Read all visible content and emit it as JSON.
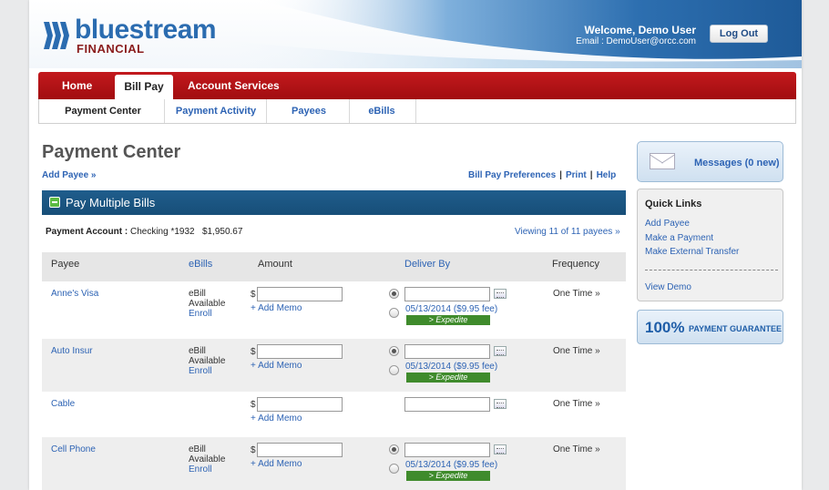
{
  "header": {
    "logo_text": "bluestream",
    "logo_sub": "FINANCIAL",
    "welcome": "Welcome, Demo User",
    "email": "Email : DemoUser@orcc.com",
    "logout_label": "Log Out"
  },
  "main_nav": {
    "tabs": [
      {
        "label": "Home"
      },
      {
        "label": "Bill Pay",
        "active": true
      },
      {
        "label": "Account Services"
      }
    ]
  },
  "sub_nav": {
    "tabs": [
      {
        "label": "Payment Center",
        "active": true
      },
      {
        "label": "Payment Activity"
      },
      {
        "label": "Payees"
      },
      {
        "label": "eBills"
      }
    ]
  },
  "page": {
    "title": "Payment Center",
    "add_payee": "Add Payee »",
    "links": [
      "Bill Pay Preferences",
      "Print",
      "Help"
    ],
    "link_separator": "|"
  },
  "panel": {
    "title": "Pay Multiple Bills",
    "account_label": "Payment Account :",
    "account_value": "Checking *1932",
    "account_balance": "$1,950.67",
    "viewing": "Viewing 11 of 11 payees »"
  },
  "table": {
    "headers": [
      "Payee",
      "eBills",
      "Amount",
      "Deliver By",
      "Frequency"
    ],
    "currency_symbol": "$",
    "memo_label": "+ Add Memo",
    "fee_label": "05/13/2014 ($9.95 fee)",
    "expedite_label": "> Expedite",
    "ebill_line1": "eBill",
    "ebill_line2": "Available",
    "enroll_label": "Enroll",
    "rows": [
      {
        "payee": "Anne's Visa",
        "ebill": true,
        "frequency": "One Time »"
      },
      {
        "payee": "Auto Insur",
        "ebill": true,
        "frequency": "One Time »"
      },
      {
        "payee": "Cable",
        "ebill": false,
        "frequency": "One Time »"
      },
      {
        "payee": "Cell Phone",
        "ebill": true,
        "frequency": "One Time »"
      }
    ]
  },
  "sidebar": {
    "messages": "Messages (0 new)",
    "quick_links_title": "Quick Links",
    "quick_links": [
      "Add Payee",
      "Make a Payment",
      "Make External Transfer"
    ],
    "view_demo": "View Demo",
    "guarantee_pct": "100%",
    "guarantee_text": "PAYMENT GUARANTEE"
  },
  "colors": {
    "brand_blue": "#2b6cb0",
    "nav_red": "#b3161a",
    "link_blue": "#2d63b4",
    "panel_blue": "#1f5d8c",
    "expedite_green": "#3f8b2c"
  }
}
